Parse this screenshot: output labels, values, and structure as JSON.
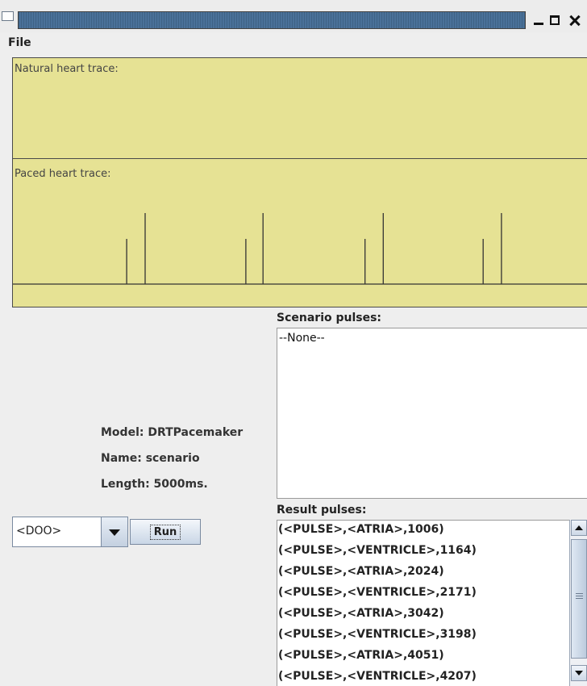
{
  "window": {
    "title": ""
  },
  "menu": {
    "file_label": "File"
  },
  "traces": {
    "natural_label": "Natural heart trace:",
    "paced_label": "Paced heart trace:"
  },
  "info": {
    "model": "Model: DRTPacemaker",
    "name": "Name: scenario",
    "length": "Length: 5000ms."
  },
  "controls": {
    "mode_value": "<DOO>",
    "run_label": "Run"
  },
  "scenario": {
    "header": "Scenario pulses:",
    "items": [
      "--None--"
    ]
  },
  "results": {
    "header": "Result pulses:",
    "rows": [
      "(<PULSE>,<ATRIA>,1006)",
      "(<PULSE>,<VENTRICLE>,1164)",
      "(<PULSE>,<ATRIA>,2024)",
      "(<PULSE>,<VENTRICLE>,2171)",
      "(<PULSE>,<ATRIA>,3042)",
      "(<PULSE>,<VENTRICLE>,3198)",
      "(<PULSE>,<ATRIA>,4051)",
      "(<PULSE>,<VENTRICLE>,4207)"
    ]
  },
  "paced_pulses": [
    {
      "type": "ATRIA",
      "time": 1006
    },
    {
      "type": "VENTRICLE",
      "time": 1164
    },
    {
      "type": "ATRIA",
      "time": 2024
    },
    {
      "type": "VENTRICLE",
      "time": 2171
    },
    {
      "type": "ATRIA",
      "time": 3042
    },
    {
      "type": "VENTRICLE",
      "time": 3198
    },
    {
      "type": "ATRIA",
      "time": 4051
    },
    {
      "type": "VENTRICLE",
      "time": 4207
    }
  ],
  "colors": {
    "trace_background": "#e6e294",
    "trace_line": "#333333",
    "title_bar": "#4a7199"
  }
}
